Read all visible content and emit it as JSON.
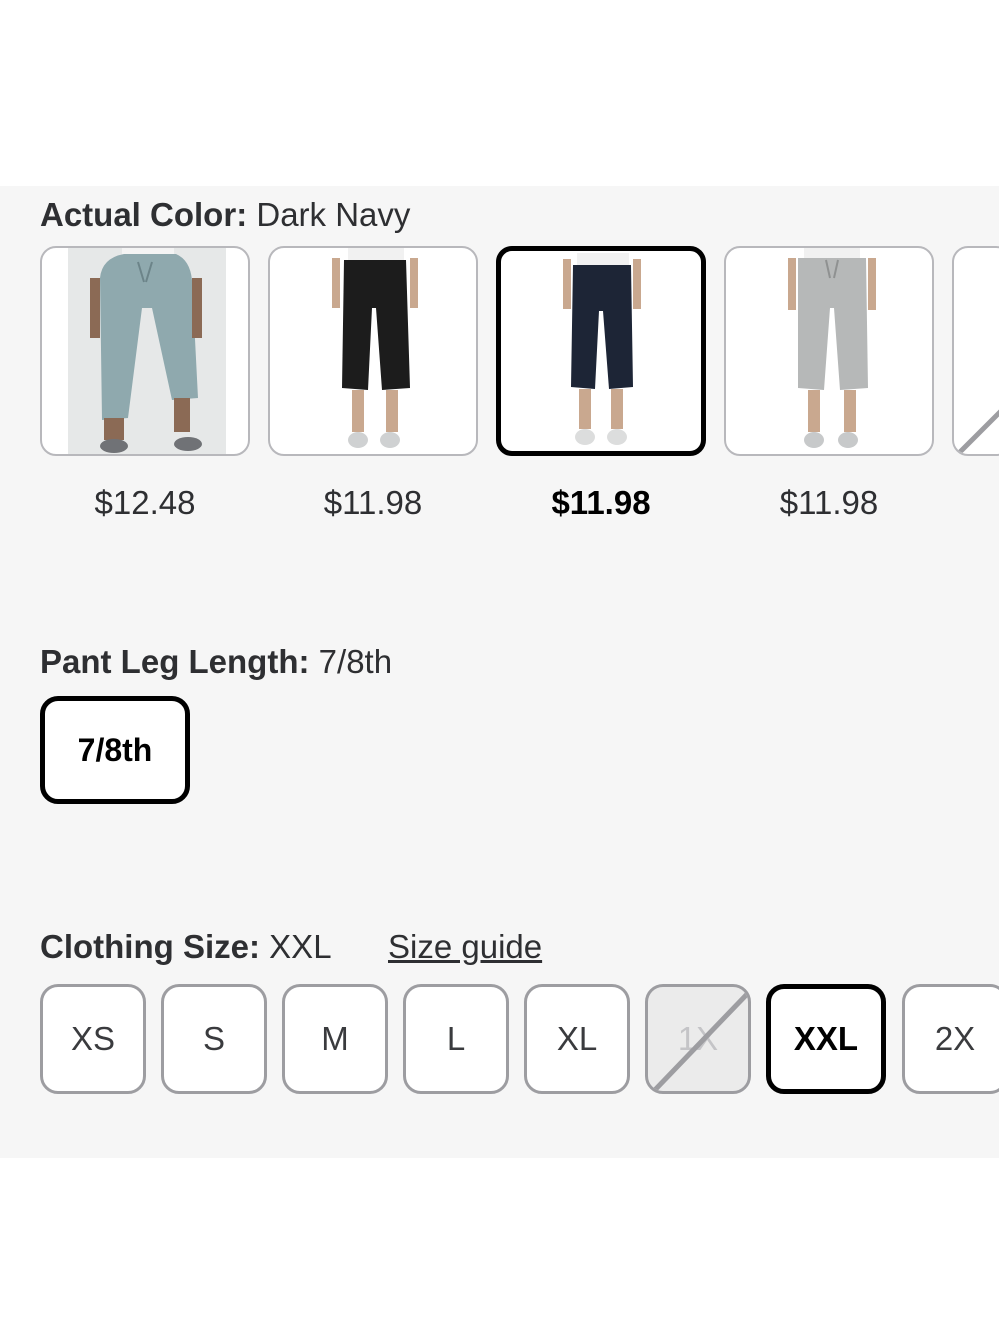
{
  "color_section": {
    "label": "Actual Color",
    "value": "Dark Navy",
    "swatches": [
      {
        "color": "light-blue",
        "price": "$12.48",
        "selected": false
      },
      {
        "color": "black",
        "price": "$11.98",
        "selected": false
      },
      {
        "color": "dark-navy",
        "price": "$11.98",
        "selected": true
      },
      {
        "color": "light-gray",
        "price": "$11.98",
        "selected": false
      }
    ]
  },
  "leg_section": {
    "label": "Pant Leg Length",
    "value": "7/8th",
    "options": [
      "7/8th"
    ]
  },
  "size_section": {
    "label": "Clothing Size",
    "value": "XXL",
    "size_guide": "Size guide",
    "options": [
      "XS",
      "S",
      "M",
      "L",
      "XL",
      "1X",
      "XXL",
      "2X"
    ],
    "unavailable": [
      "1X"
    ],
    "selected": "XXL"
  },
  "colors": {
    "selected_border": "#000000",
    "default_border": "#9d9da1",
    "panel_bg": "#f6f6f6",
    "pant_light_blue": "#8fa9ae",
    "pant_black": "#1c1c1c",
    "pant_navy": "#1d2536",
    "pant_gray": "#b6b8b8"
  }
}
